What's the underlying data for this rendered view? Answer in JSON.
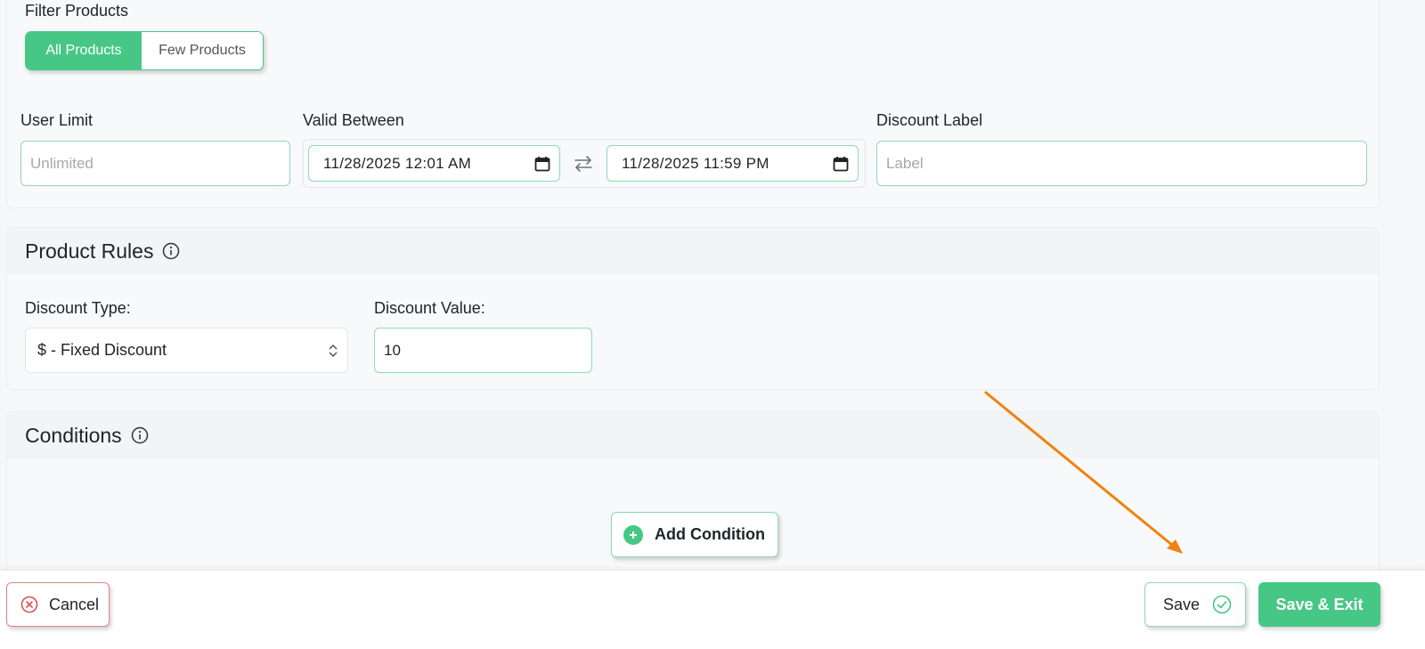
{
  "filter": {
    "label": "Filter Products",
    "options": [
      {
        "label": "All Products",
        "active": true
      },
      {
        "label": "Few Products",
        "active": false
      }
    ]
  },
  "user_limit": {
    "label": "User Limit",
    "value": "",
    "placeholder": "Unlimited"
  },
  "valid_between": {
    "label": "Valid Between",
    "start": "11/28/2025 12:01 AM",
    "end": "11/28/2025 11:59 PM"
  },
  "discount_label": {
    "label": "Discount Label",
    "value": "",
    "placeholder": "Label"
  },
  "product_rules": {
    "title": "Product Rules",
    "discount_type": {
      "label": "Discount Type:",
      "value": "$ - Fixed Discount"
    },
    "discount_value": {
      "label": "Discount Value:",
      "value": "10"
    }
  },
  "conditions": {
    "title": "Conditions",
    "add_label": "Add Condition"
  },
  "footer": {
    "cancel_label": "Cancel",
    "save_label": "Save",
    "save_exit_label": "Save & Exit"
  },
  "colors": {
    "accent_green": "#47c786",
    "cancel_red": "#d9534f",
    "annotation_orange": "#f0820f"
  },
  "icons": {
    "calendar": "calendar-icon",
    "swap": "swap-arrows-icon",
    "info": "info-icon",
    "chevrons": "chevron-up-down-icon",
    "plus": "plus-circle-icon",
    "cancel": "close-circle-icon",
    "save": "check-circle-icon",
    "annotation": "annotation-arrow"
  }
}
